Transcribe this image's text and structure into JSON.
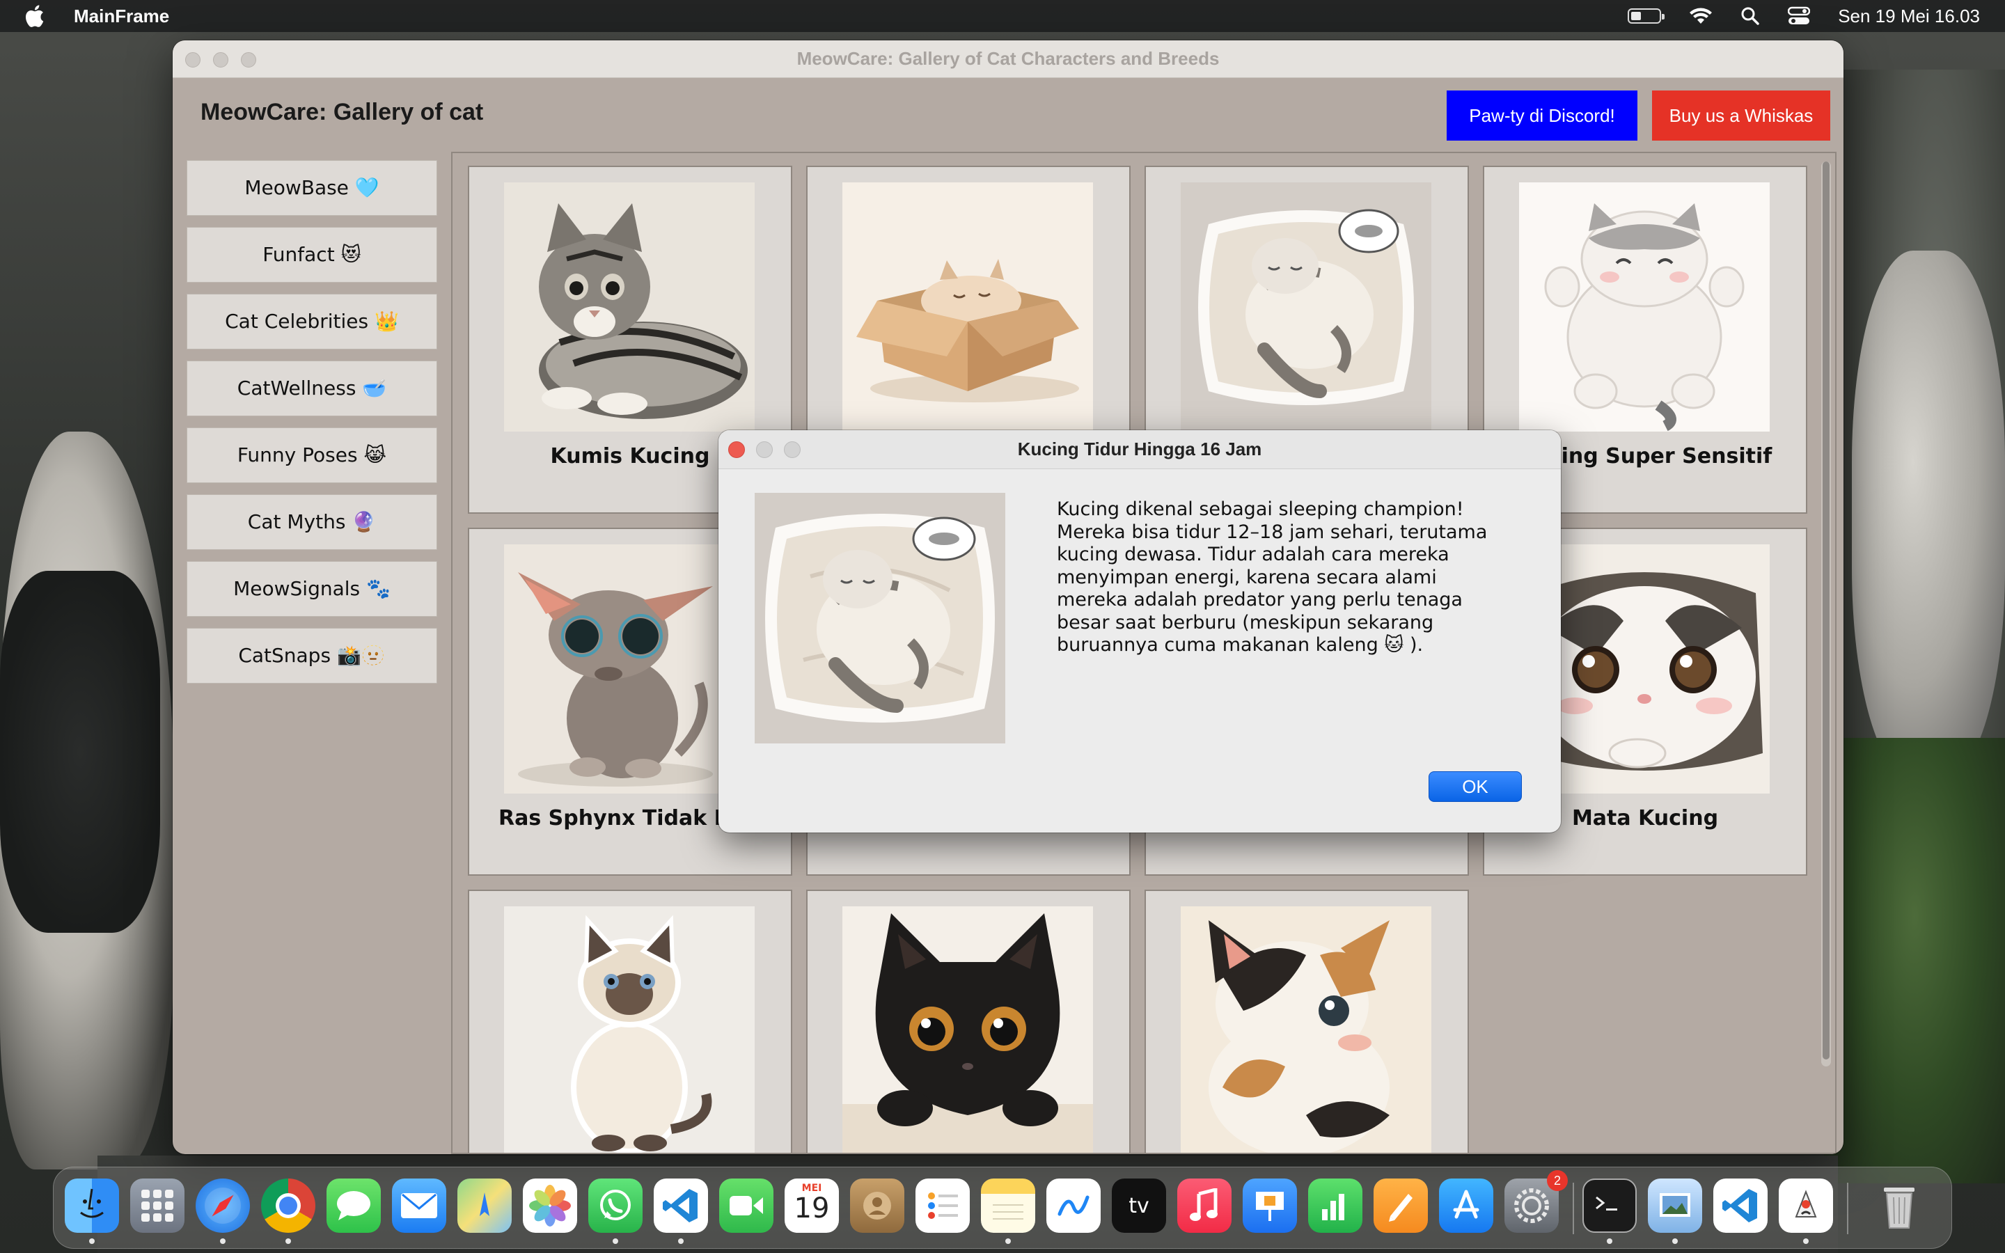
{
  "menubar": {
    "app_name": "MainFrame",
    "clock": "Sen 19 Mei  16.03",
    "battery_level": 0.35
  },
  "window": {
    "title": "MeowCare: Gallery of Cat Characters and Breeds",
    "app_title": "MeowCare: Gallery of cat",
    "discord_button": "Paw-ty di Discord!",
    "whiskas_button": "Buy us a Whiskas",
    "colors": {
      "discord": "#0000ff",
      "whiskas": "#e53226"
    }
  },
  "sidebar": {
    "items": [
      {
        "label": "MeowBase 🩵"
      },
      {
        "label": "Funfact 😻"
      },
      {
        "label": "Cat Celebrities 👑"
      },
      {
        "label": "CatWellness 🥣"
      },
      {
        "label": "Funny Poses 😹"
      },
      {
        "label": "Cat Myths 🔮"
      },
      {
        "label": "MeowSignals 🐾"
      },
      {
        "label": "CatSnaps 📸🫥"
      }
    ]
  },
  "gallery": {
    "cards": [
      {
        "caption": "Kumis Kucing",
        "icon": "tabby-cat-illustration"
      },
      {
        "caption": "",
        "icon": "cat-in-box-illustration"
      },
      {
        "caption": "",
        "icon": "sleeping-cat-pillow-illustration"
      },
      {
        "caption": "Kucing Super Sensitif",
        "icon": "chubby-cat-illustration"
      },
      {
        "caption": "Ras Sphynx Tidak Berl",
        "icon": "sphynx-cat-illustration"
      },
      {
        "caption": "",
        "icon": "hidden-card"
      },
      {
        "caption": "",
        "icon": "hidden-card"
      },
      {
        "caption": "Mata Kucing",
        "icon": "peeking-cat-illustration"
      },
      {
        "caption": "",
        "icon": "siamese-cat-illustration"
      },
      {
        "caption": "",
        "icon": "black-cat-illustration"
      },
      {
        "caption": "",
        "icon": "calico-kitten-illustration"
      }
    ]
  },
  "dialog": {
    "title": "Kucing Tidur Hingga 16 Jam",
    "body": "Kucing dikenal sebagai sleeping champion!\nMereka bisa tidur 12–18 jam sehari, terutama\nkucing dewasa. Tidur adalah cara mereka\nmenyimpan energi, karena secara alami\nmereka adalah predator yang perlu tenaga\nbesar saat berburu (meskipun sekarang\nburuannya cuma makanan kaleng 🐱 ).",
    "ok_label": "OK",
    "icon": "sleeping-cat-pillow-illustration"
  },
  "dock": {
    "calendar_month": "MEI",
    "calendar_day": "19",
    "tv_label": "tv",
    "settings_badge": "2",
    "apps": [
      "finder",
      "launchpad",
      "safari",
      "chrome",
      "messages",
      "mail",
      "maps",
      "photos",
      "whatsapp",
      "vscode",
      "facetime",
      "calendar",
      "contacts",
      "reminders",
      "notes",
      "freeform",
      "tv",
      "music",
      "keynote",
      "numbers",
      "pages",
      "app-store",
      "system-settings",
      "terminal",
      "preview",
      "vscode-2",
      "java",
      "trash"
    ]
  }
}
